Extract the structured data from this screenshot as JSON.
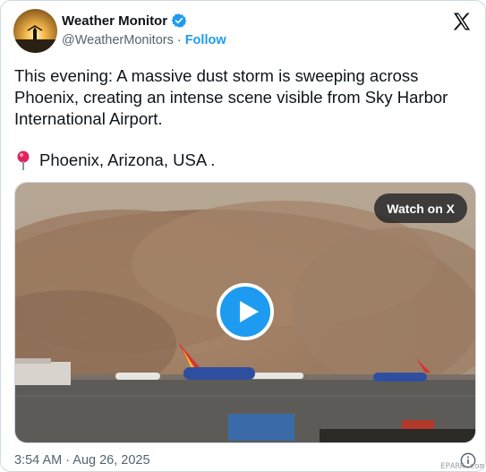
{
  "author": {
    "display_name": "Weather Monitor",
    "handle": "@WeatherMonitors",
    "separator": "·",
    "follow_label": "Follow",
    "verified": true
  },
  "post": {
    "text": "This evening: A massive dust storm is sweeping across Phoenix, creating an intense scene visible from Sky Harbor International Airport.",
    "location_icon": "pin-icon",
    "location": "Phoenix, Arizona, USA ."
  },
  "media": {
    "watch_label": "Watch on X",
    "play_icon": "play-icon"
  },
  "footer": {
    "timestamp": "3:54 AM · Aug 26, 2025",
    "info_icon": "info-icon"
  },
  "watermark": "EPARK.com",
  "colors": {
    "accent": "#1d9bf0",
    "text": "#0f1419",
    "muted": "#536471"
  }
}
